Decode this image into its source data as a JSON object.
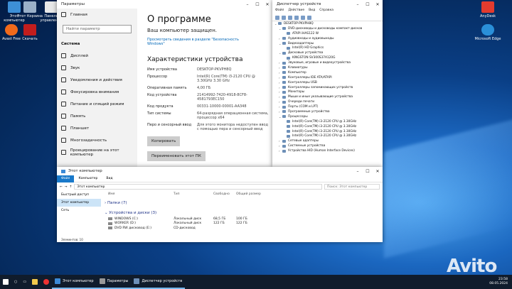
{
  "desktop": {
    "icons": [
      "Этот компьютер",
      "Этот Корзина",
      "Панель управления",
      "Avast Free",
      "Скачать"
    ],
    "anydesk": "AnyDesk",
    "edge": "Microsoft Edge"
  },
  "settings": {
    "title": "Параметры",
    "home": "Главная",
    "search_placeholder": "Найти параметр",
    "section": "Система",
    "nav": [
      "Дисплей",
      "Звук",
      "Уведомления и действия",
      "Фокусировка внимания",
      "Питание и спящий режим",
      "Память",
      "Планшет",
      "Многозадачность",
      "Проецирование на этот компьютер"
    ],
    "heading": "О программе",
    "protected": "Ваш компьютер защищен.",
    "link": "Просмотреть сведения в разделе \"Безопасность Windows\"",
    "spec_heading": "Характеристики устройства",
    "specs": [
      {
        "k": "Имя устройства",
        "v": "DESKTOP-PKVPH8Q"
      },
      {
        "k": "Процессор",
        "v": "Intel(R) Core(TM) i3-2120 CPU @ 3.30GHz   3.30 GHz"
      },
      {
        "k": "Оперативная память",
        "v": "4,00 ГБ"
      },
      {
        "k": "Код устройства",
        "v": "21414992-7420-4918-8CF8-4581793EC150"
      },
      {
        "k": "Код продукта",
        "v": "00331-10000-00001-AA348"
      },
      {
        "k": "Тип системы",
        "v": "64-разрядная операционная система, процессор x64"
      },
      {
        "k": "Перо и сенсорный ввод",
        "v": "Для этого монитора недоступен ввод с помощью пера и сенсорный ввод"
      }
    ],
    "copy_btn": "Копировать",
    "rename_btn": "Переименовать этот ПК"
  },
  "devmgr": {
    "title": "Диспетчер устройств",
    "menu": [
      "Файл",
      "Действие",
      "Вид",
      "Справка"
    ],
    "tree": [
      {
        "t": "DESKTOP-PKVPH8Q",
        "l": 0,
        "e": "⌄"
      },
      {
        "t": "DVD-дисководы и дисководы компакт-дисков",
        "l": 1,
        "e": "⌄"
      },
      {
        "t": "ATAPI iHAS122   W",
        "l": 2,
        "e": ""
      },
      {
        "t": "Аудиовходы и аудиовыходы",
        "l": 1,
        "e": "›"
      },
      {
        "t": "Видеоадаптеры",
        "l": 1,
        "e": "⌄"
      },
      {
        "t": "Intel(R) HD Graphics",
        "l": 2,
        "e": ""
      },
      {
        "t": "Дисковые устройства",
        "l": 1,
        "e": "⌄"
      },
      {
        "t": "KINGSTON SV300S37A120G",
        "l": 2,
        "e": ""
      },
      {
        "t": "Звуковые, игровые и видеоустройства",
        "l": 1,
        "e": "›"
      },
      {
        "t": "Клавиатуры",
        "l": 1,
        "e": "›"
      },
      {
        "t": "Компьютер",
        "l": 1,
        "e": "›"
      },
      {
        "t": "Контроллеры IDE ATA/ATAPI",
        "l": 1,
        "e": "›"
      },
      {
        "t": "Контроллеры USB",
        "l": 1,
        "e": "›"
      },
      {
        "t": "Контроллеры запоминающих устройств",
        "l": 1,
        "e": "›"
      },
      {
        "t": "Мониторы",
        "l": 1,
        "e": "›"
      },
      {
        "t": "Мыши и иные указывающие устройства",
        "l": 1,
        "e": "›"
      },
      {
        "t": "Очереди печати",
        "l": 1,
        "e": "›"
      },
      {
        "t": "Порты (COM и LPT)",
        "l": 1,
        "e": "›"
      },
      {
        "t": "Программные устройства",
        "l": 1,
        "e": "›"
      },
      {
        "t": "Процессоры",
        "l": 1,
        "e": "⌄"
      },
      {
        "t": "Intel(R) Core(TM) i3-2120 CPU @ 3.30GHz",
        "l": 2,
        "e": ""
      },
      {
        "t": "Intel(R) Core(TM) i3-2120 CPU @ 3.30GHz",
        "l": 2,
        "e": ""
      },
      {
        "t": "Intel(R) Core(TM) i3-2120 CPU @ 3.30GHz",
        "l": 2,
        "e": ""
      },
      {
        "t": "Intel(R) Core(TM) i3-2120 CPU @ 3.30GHz",
        "l": 2,
        "e": ""
      },
      {
        "t": "Сетевые адаптеры",
        "l": 1,
        "e": "›"
      },
      {
        "t": "Системные устройства",
        "l": 1,
        "e": "›"
      },
      {
        "t": "Устройства HID (Human Interface Devices)",
        "l": 1,
        "e": "›"
      }
    ]
  },
  "explorer": {
    "title": "Этот компьютер",
    "ribbon": [
      "Файл",
      "Компьютер",
      "Вид"
    ],
    "address": "Этот компьютер",
    "search_placeholder": "Поиск: Этот компьютер",
    "nav": [
      "Быстрый доступ",
      "Этот компьютер",
      "Сеть"
    ],
    "cols": [
      "Имя",
      "Тип",
      "Свободно",
      "Общий размер"
    ],
    "folders_group": "Папки (7)",
    "drives_group": "Устройства и диски (3)",
    "drives": [
      {
        "n": "WINDOWS (C:)",
        "t": "Локальный диск",
        "f": "68,5 ГБ",
        "s": "100 ГБ"
      },
      {
        "n": "WORKER (D:)",
        "t": "Локальный диск",
        "f": "122 ГБ",
        "s": "122 ГБ"
      },
      {
        "n": "DVD RW дисковод (E:)",
        "t": "CD-дисковод",
        "f": "",
        "s": ""
      }
    ],
    "status": "Элементов: 10"
  },
  "taskbar": {
    "items": [
      "Этот компьютер",
      "Параметры",
      "Диспетчер устройств"
    ],
    "time": "23:58",
    "date": "08.05.2024"
  },
  "watermark": "Avito"
}
